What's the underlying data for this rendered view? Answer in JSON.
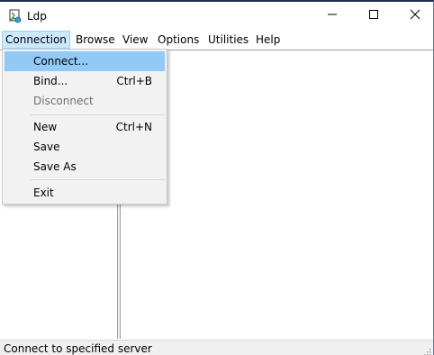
{
  "window": {
    "title": "Ldp",
    "app_icon": "ldp-app-icon"
  },
  "caption_buttons": {
    "minimize": "minimize-icon",
    "maximize": "maximize-icon",
    "close": "close-icon"
  },
  "menubar": {
    "items": [
      "Connection",
      "Browse",
      "View",
      "Options",
      "Utilities",
      "Help"
    ],
    "active_index": 0
  },
  "connection_menu": {
    "items": [
      {
        "label": "Connect...",
        "shortcut": "",
        "state": "highlighted"
      },
      {
        "label": "Bind...",
        "shortcut": "Ctrl+B",
        "state": "enabled"
      },
      {
        "label": "Disconnect",
        "shortcut": "",
        "state": "disabled"
      },
      {
        "label": "New",
        "shortcut": "Ctrl+N",
        "state": "enabled"
      },
      {
        "label": "Save",
        "shortcut": "",
        "state": "enabled"
      },
      {
        "label": "Save As",
        "shortcut": "",
        "state": "enabled"
      },
      {
        "label": "Exit",
        "shortcut": "",
        "state": "enabled"
      }
    ]
  },
  "statusbar": {
    "text": "Connect to specified server"
  },
  "colors": {
    "menu_highlight": "#91c9f7",
    "menubar_active": "#cce8ff",
    "disabled_text": "#6d6d6d",
    "title_border": "#1f2d4d"
  }
}
